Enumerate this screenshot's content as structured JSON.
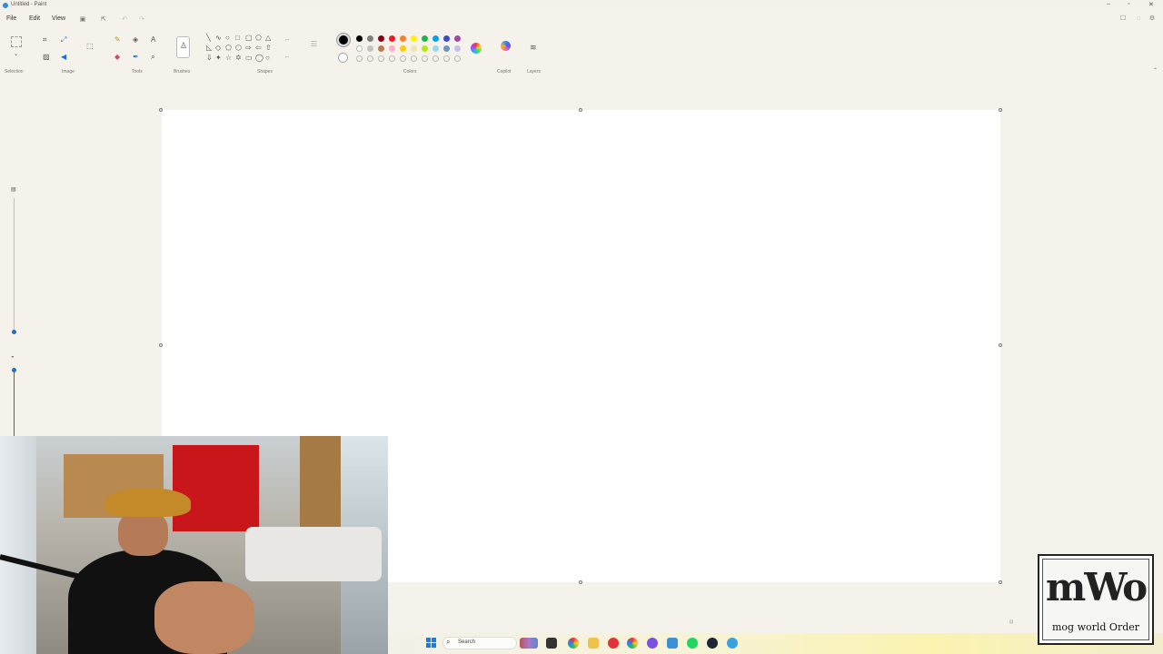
{
  "window": {
    "title": "Untitled - Paint",
    "controls": [
      "–",
      "▫",
      "✕"
    ]
  },
  "menu": {
    "file": "File",
    "edit": "Edit",
    "view": "View"
  },
  "ribbon": {
    "groups": {
      "selection": "Selection",
      "image": "Image",
      "tools": "Tools",
      "brushes": "Brushes",
      "shapes": "Shapes",
      "colors": "Colors",
      "copilot": "Copilot",
      "layers": "Layers"
    },
    "palette_row1": [
      "#000000",
      "#7f7f7f",
      "#880015",
      "#ed1c24",
      "#ff7f27",
      "#fff200",
      "#22b14c",
      "#00a2e8",
      "#3f48cc",
      "#a349a4"
    ],
    "palette_row2": [
      "#ffffff",
      "#c3c3c3",
      "#b97a57",
      "#ffaec9",
      "#ffc90e",
      "#efe4b0",
      "#b5e61d",
      "#99d9ea",
      "#7092be",
      "#c8bfe7"
    ],
    "primary_color": "#000000",
    "secondary_color": "#ffffff"
  },
  "taskbar": {
    "search_label": "Search"
  },
  "overlay": {
    "logo_letters": "mWo",
    "logo_caption": "mog world Order"
  }
}
